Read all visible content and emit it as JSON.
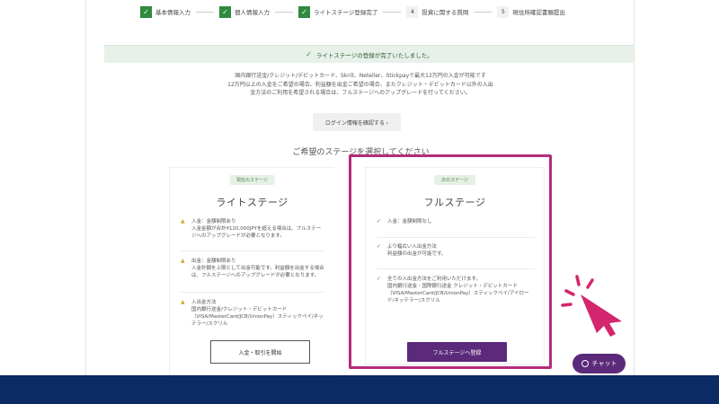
{
  "steps": [
    {
      "label": "基本情報入力",
      "state": "done",
      "marker": "✓"
    },
    {
      "label": "個人情報入力",
      "state": "done",
      "marker": "✓"
    },
    {
      "label": "ライトステージ登録完了",
      "state": "done",
      "marker": "✓"
    },
    {
      "label": "投資に関する質問",
      "state": "todo",
      "marker": "4"
    },
    {
      "label": "現住所確認書類提出",
      "state": "todo",
      "marker": "5"
    }
  ],
  "banner": {
    "text": "ライトステージの登録が完了いたしました。"
  },
  "intro": {
    "line1": "国内銀行送金/クレジット/デビットカード、Skrill、Neteller、Stickpayで最大12万円の入金が可能です",
    "line2": "12万円以上の入金をご希望の場合、利益額を出金ご希望の場合、またクレジット・デビットカード以外の入出",
    "line3": "金方法のご利用を希望される場合は、フルステージへのアップグレードを行ってください。"
  },
  "login_button": "ログイン情報を確認する ›",
  "choose_heading": "ご希望のステージを選択してください",
  "lite_card": {
    "chip": "現在のステージ",
    "title": "ライトステージ",
    "features": [
      {
        "title": "入金：金額制限あり",
        "body": "入金金額が合計¥120,000JPYを超える場合は、フルステージへのアップグレードが必要となります。"
      },
      {
        "title": "出金：金額制限あり",
        "body": "入金計額を上限として出金可能です。利益額を出金する場合は、フルステージへのアップグレードが必要となります。"
      },
      {
        "title": "入出金方法",
        "body": "国内銀行送金/クレジット・デビットカード（VISA/MasterCard/JCB/UnionPay）スティックペイ/ネッテラー/スクリル"
      }
    ],
    "button": "入金・取引を開始"
  },
  "full_card": {
    "chip": "次のステージ",
    "title": "フルステージ",
    "features": [
      {
        "title": "入金：金額制限なし",
        "body": ""
      },
      {
        "title": "より幅広い入出金方法",
        "body": "利益額の出金が可能です。"
      },
      {
        "title": "全ての入出金方法をご利用いただけます。",
        "body": "国内銀行送金・国際銀行送金 クレジット・デビットカード（VISA/MasterCard/JCB/UnionPay）スティックペイ/アイロード/ネッテラー/スクリル"
      }
    ],
    "button": "フルステージへ登録"
  },
  "chat_button": "チャット",
  "icons": {
    "tap": "tap-hand-icon",
    "chat": "chat-bubble-icon",
    "warn": "warning-icon",
    "tick": "check-icon"
  },
  "colors": {
    "brand_purple": "#5b2a7a",
    "highlight": "#b42b7a",
    "footer": "#0c2a63",
    "success": "#2f8a3e"
  }
}
